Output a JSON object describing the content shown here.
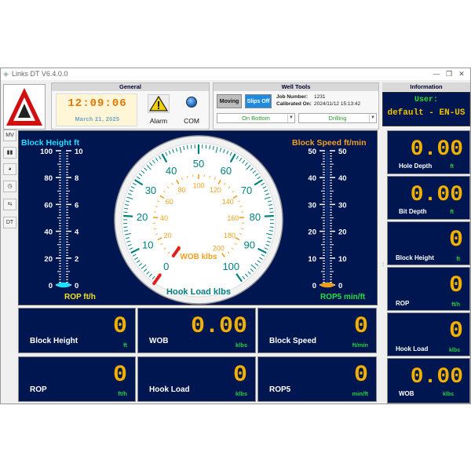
{
  "window": {
    "title": "Links DT V6.4.0.0"
  },
  "general": {
    "title": "General",
    "time": "12:09:06",
    "date": "March 21, 2025",
    "alarm_label": "Alarm",
    "com_label": "COM"
  },
  "well_tools": {
    "title": "Well Tools",
    "moving_label": "Moving",
    "slips_label": "Slips Off",
    "job_label": "Job Number:",
    "job_value": "1231",
    "calibrated_label": "Calibrated On:",
    "calibrated_value": "2024/11/12 15:13:42",
    "position_select": "On Bottom",
    "mode_select": "Drilling"
  },
  "information": {
    "title": "Information",
    "user_label": "User:",
    "user_value": "default - EN-US"
  },
  "side_buttons": [
    "MV",
    "bar-chart-icon",
    "pie-chart-icon",
    "clock-icon",
    "sliders-icon",
    "DT"
  ],
  "left_gauge": {
    "title": "Block Height ft",
    "bottom_label": "ROP ft/h",
    "outer_ticks": [
      "100",
      "80",
      "60",
      "40",
      "20",
      "0"
    ],
    "inner_ticks": [
      "10",
      "8",
      "6",
      "4",
      "2",
      "0"
    ]
  },
  "right_gauge": {
    "title": "Block Speed ft/min",
    "bottom_label": "ROP5 min/ft",
    "outer_ticks": [
      "50",
      "40",
      "30",
      "20",
      "10",
      "0"
    ],
    "inner_ticks": [
      "50",
      "40",
      "30",
      "20",
      "10",
      "0"
    ]
  },
  "dial": {
    "outer_labels": [
      "0",
      "10",
      "20",
      "30",
      "40",
      "50",
      "60",
      "70",
      "80",
      "90",
      "100"
    ],
    "inner_labels": [
      "0",
      "20",
      "40",
      "60",
      "80",
      "100",
      "120",
      "140",
      "160",
      "180",
      "200"
    ],
    "inner_unit": "WOB klbs",
    "outer_unit": "Hook Load klbs",
    "hook_load_value": 0,
    "wob_value": 0
  },
  "tiles": [
    {
      "label": "Block Height",
      "value": "0",
      "unit": "ft"
    },
    {
      "label": "WOB",
      "value": "0.00",
      "unit": "klbs"
    },
    {
      "label": "Block Speed",
      "value": "0",
      "unit": "ft/min"
    },
    {
      "label": "ROP",
      "value": "0",
      "unit": "ft/h"
    },
    {
      "label": "Hook Load",
      "value": "0",
      "unit": "klbs"
    },
    {
      "label": "ROP5",
      "value": "0",
      "unit": "min/ft"
    }
  ],
  "right_tiles": [
    {
      "label": "Hole Depth",
      "value": "0.00",
      "unit": "ft"
    },
    {
      "label": "Bit Depth",
      "value": "0.00",
      "unit": "ft"
    },
    {
      "label": "Block Height",
      "value": "0",
      "unit": "ft"
    },
    {
      "label": "ROP",
      "value": "0",
      "unit": "ft/h"
    },
    {
      "label": "Hook Load",
      "value": "0",
      "unit": "klbs"
    },
    {
      "label": "WOB",
      "value": "0.00",
      "unit": "klbs"
    }
  ],
  "colors": {
    "panel_bg": "#001650",
    "digit": "#f0b000",
    "unit": "#20d040",
    "dial_outer": "#008080",
    "dial_inner": "#f0a020",
    "needle": "#e02020",
    "left_title": "#20e0ff",
    "right_title": "#f0a020"
  }
}
